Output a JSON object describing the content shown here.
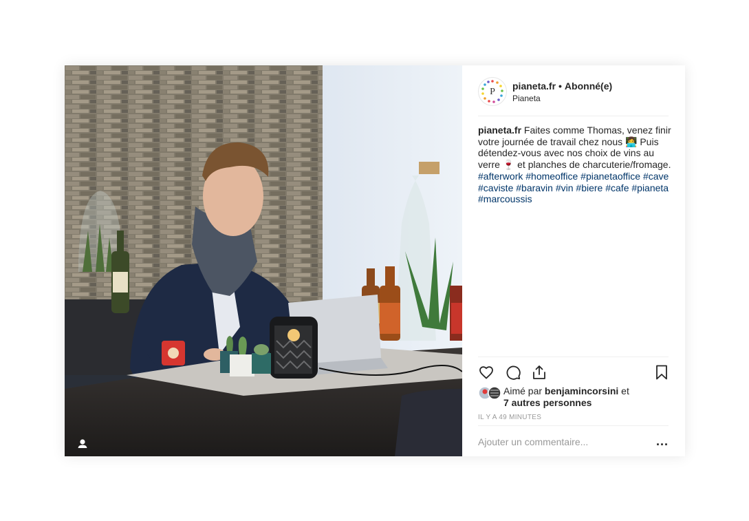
{
  "post": {
    "username": "pianeta.fr",
    "separator": "•",
    "follow_status": "Abonné(e)",
    "location": "Pianeta",
    "caption": {
      "username": "pianeta.fr",
      "text_1": " Faites comme Thomas, venez finir votre journée de travail chez nous ",
      "emoji_1": "👩‍💻",
      "text_2": " Puis détendez-vous avec nos choix de vins au verre ",
      "emoji_2": "🍷",
      "text_3": "  et planches de charcuterie/fromage.",
      "hashtags": [
        "#afterwork",
        "#homeoffice",
        "#pianetaoffice",
        "#cave",
        "#caviste",
        "#baravin",
        "#vin",
        "#biere",
        "#cafe",
        "#pianeta",
        "#marcoussis"
      ]
    },
    "likes": {
      "prefix": "Aimé par ",
      "user": "benjamincorsini",
      "suffix": " et",
      "others": "7 autres personnes"
    },
    "time_ago": "IL Y A 49 MINUTES",
    "comment": {
      "placeholder": "Ajouter un commentaire...",
      "more_label": "..."
    },
    "icons": {
      "like": "heart-icon",
      "comment": "comment-icon",
      "share": "share-icon",
      "save": "bookmark-icon",
      "tagged": "user-tag-icon"
    },
    "colors": {
      "text": "#262626",
      "hashtag": "#003569",
      "muted": "#999999",
      "border": "#efefef"
    }
  }
}
